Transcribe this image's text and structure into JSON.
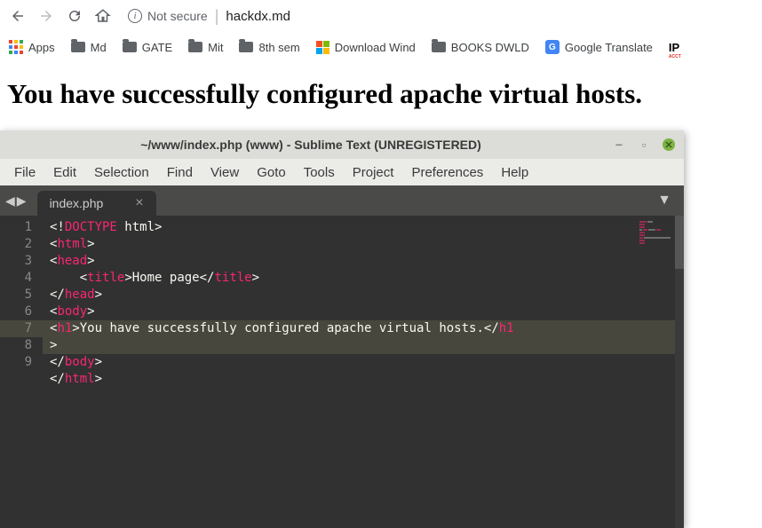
{
  "browser": {
    "security_label": "Not secure",
    "url": "hackdx.md"
  },
  "bookmarks": {
    "apps_label": "Apps",
    "items": [
      {
        "label": "Md"
      },
      {
        "label": "GATE"
      },
      {
        "label": "Mit"
      },
      {
        "label": "8th sem"
      },
      {
        "label": "Download Wind"
      },
      {
        "label": "BOOKS DWLD"
      },
      {
        "label": "Google Translate"
      }
    ]
  },
  "page": {
    "heading": "You have successfully configured apache virtual hosts."
  },
  "sublime": {
    "title": "~/www/index.php (www) - Sublime Text (UNREGISTERED)",
    "menu": [
      "File",
      "Edit",
      "Selection",
      "Find",
      "View",
      "Goto",
      "Tools",
      "Project",
      "Preferences",
      "Help"
    ],
    "tab_name": "index.php",
    "line_numbers": [
      "1",
      "2",
      "3",
      "4",
      "5",
      "6",
      "7",
      "",
      "8",
      "9"
    ],
    "code": {
      "doctype_decl": "DOCTYPE",
      "doctype_val": " html",
      "html_tag": "html",
      "head_tag": "head",
      "title_tag": "title",
      "title_text": "Home page",
      "body_tag": "body",
      "h1_tag": "h1",
      "h1_text": "You have successfully configured apache virtual hosts."
    }
  }
}
